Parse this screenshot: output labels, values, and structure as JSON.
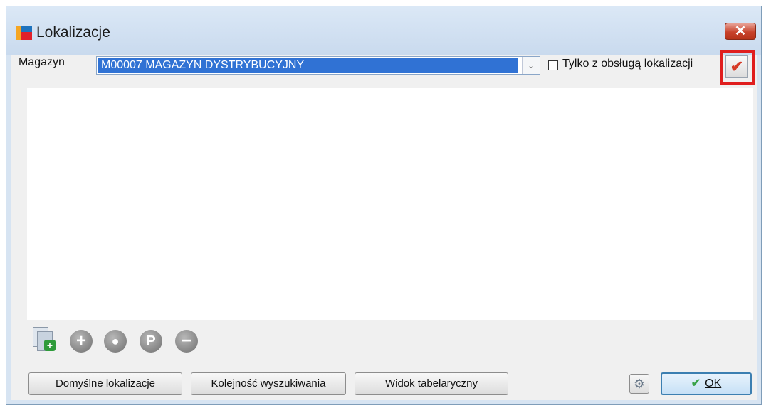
{
  "window": {
    "title": "Lokalizacje",
    "close_glyph": "✕"
  },
  "filter": {
    "magazyn_label": "Magazyn",
    "magazyn_value": "M00007 MAGAZYN DYSTRYBUCYJNY",
    "only_with_locations_label": "Tylko z obsługą lokalizacji",
    "only_with_locations_checked": false,
    "apply_icon": "checkmark-icon"
  },
  "toolbar": {
    "icons": [
      "new-document-icon",
      "add-icon",
      "preview-icon",
      "p-icon",
      "remove-icon"
    ],
    "add_glyph": "+",
    "p_glyph": "P",
    "remove_glyph": "−"
  },
  "buttons": {
    "default_locations": "Domyślne lokalizacje",
    "search_order": "Kolejność wyszukiwania",
    "table_view": "Widok tabelaryczny",
    "ok": "OK"
  },
  "colors": {
    "selection": "#3072d4",
    "highlight_box": "#e01e1e",
    "close_button": "#c8432c"
  }
}
